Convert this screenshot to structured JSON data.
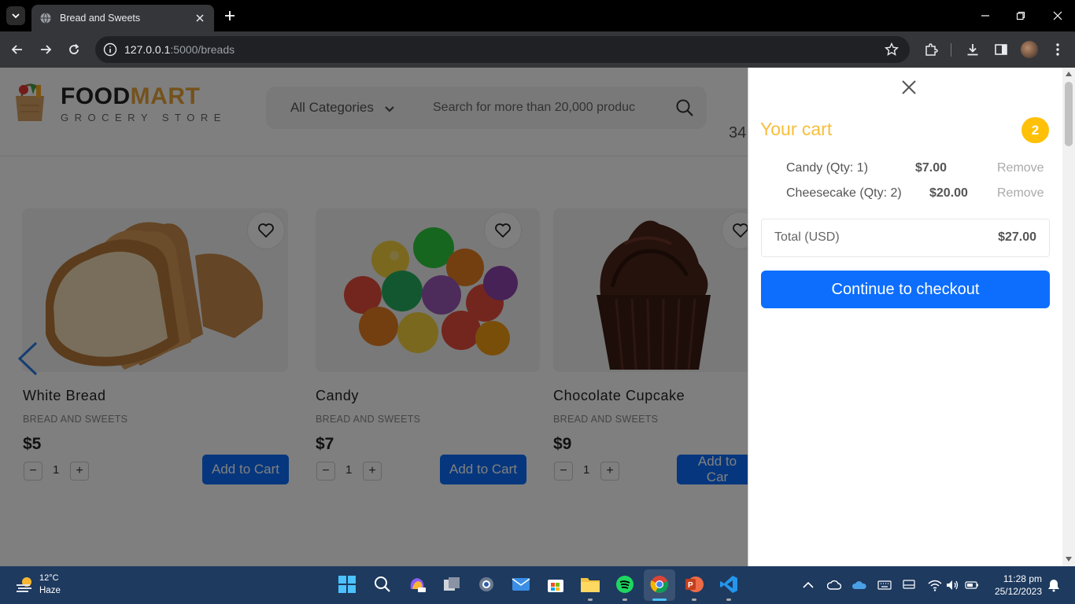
{
  "browser": {
    "tab_title": "Bread and Sweets",
    "url_host": "127.0.0.1",
    "url_rest": ":5000/breads"
  },
  "header": {
    "brand_first": "FOOD",
    "brand_second": "MART",
    "tagline": "GROCERY STORE",
    "category_label": "All Categories",
    "search_placeholder": "Search for more than 20,000 produc",
    "phone_fragment": "34"
  },
  "products": [
    {
      "name": "White Bread",
      "category": "BREAD AND SWEETS",
      "price": "$5",
      "qty": "1",
      "add_label": "Add to Cart"
    },
    {
      "name": "Candy",
      "category": "BREAD AND SWEETS",
      "price": "$7",
      "qty": "1",
      "add_label": "Add to Cart"
    },
    {
      "name": "Chocolate Cupcake",
      "category": "BREAD AND SWEETS",
      "price": "$9",
      "qty": "1",
      "add_label": "Add to Car"
    }
  ],
  "cart": {
    "title": "Your cart",
    "count": "2",
    "items": [
      {
        "name": "Candy (Qty: 1)",
        "price": "$7.00",
        "remove": "Remove"
      },
      {
        "name": "Cheesecake (Qty: 2)",
        "price": "$20.00",
        "remove": "Remove"
      }
    ],
    "total_label": "Total (USD)",
    "total_value": "$27.00",
    "checkout_label": "Continue to checkout"
  },
  "taskbar": {
    "temperature": "12°C",
    "condition": "Haze",
    "time": "11:28 pm",
    "date": "25/12/2023"
  },
  "colors": {
    "primary": "#0d6efd",
    "cart_title": "#f7be3b",
    "badge": "#ffc107",
    "brand_accent": "#e9a53a"
  }
}
